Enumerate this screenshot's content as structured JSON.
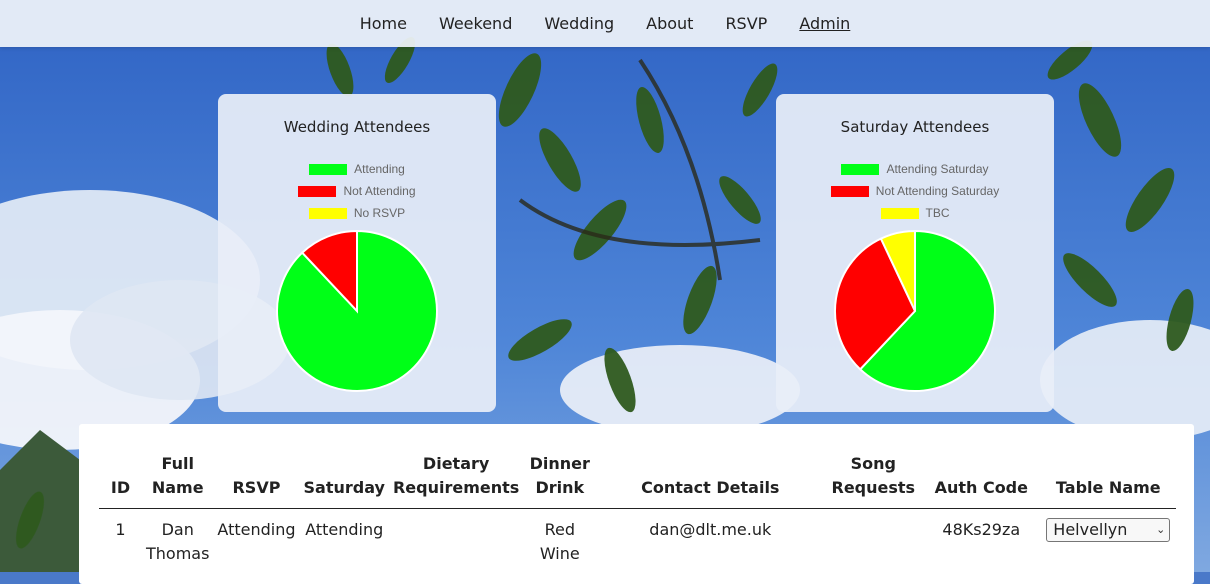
{
  "nav": {
    "items": [
      {
        "label": "Home"
      },
      {
        "label": "Weekend"
      },
      {
        "label": "Wedding"
      },
      {
        "label": "About"
      },
      {
        "label": "RSVP"
      },
      {
        "label": "Admin",
        "active": true
      }
    ]
  },
  "charts": {
    "wedding": {
      "title": "Wedding Attendees"
    },
    "saturday": {
      "title": "Saturday Attendees"
    }
  },
  "chart_data": [
    {
      "type": "pie",
      "title": "Wedding Attendees",
      "legend_placement": "top",
      "categories": [
        "Attending",
        "Not Attending",
        "No RSVP"
      ],
      "values": [
        88,
        12,
        0
      ],
      "colors": [
        "#00ff17",
        "#ff0000",
        "#ffff00"
      ]
    },
    {
      "type": "pie",
      "title": "Saturday Attendees",
      "legend_placement": "top",
      "categories": [
        "Attending Saturday",
        "Not Attending Saturday",
        "TBC"
      ],
      "values": [
        62,
        31,
        7
      ],
      "colors": [
        "#00ff17",
        "#ff0000",
        "#ffff00"
      ]
    }
  ],
  "table": {
    "headers": [
      "ID",
      "Full Name",
      "RSVP",
      "Saturday",
      "Dietary Requirements",
      "Dinner Drink",
      "Contact Details",
      "Song Requests",
      "Auth Code",
      "Table Name"
    ],
    "rows": [
      {
        "id": "1",
        "full_name": "Dan Thomas",
        "rsvp": "Attending",
        "saturday": "Attending",
        "dietary": "",
        "drink": "Red Wine",
        "contact": "dan@dlt.me.uk",
        "song": "",
        "auth_code": "48Ks29za",
        "table_name": "Helvellyn"
      }
    ]
  }
}
